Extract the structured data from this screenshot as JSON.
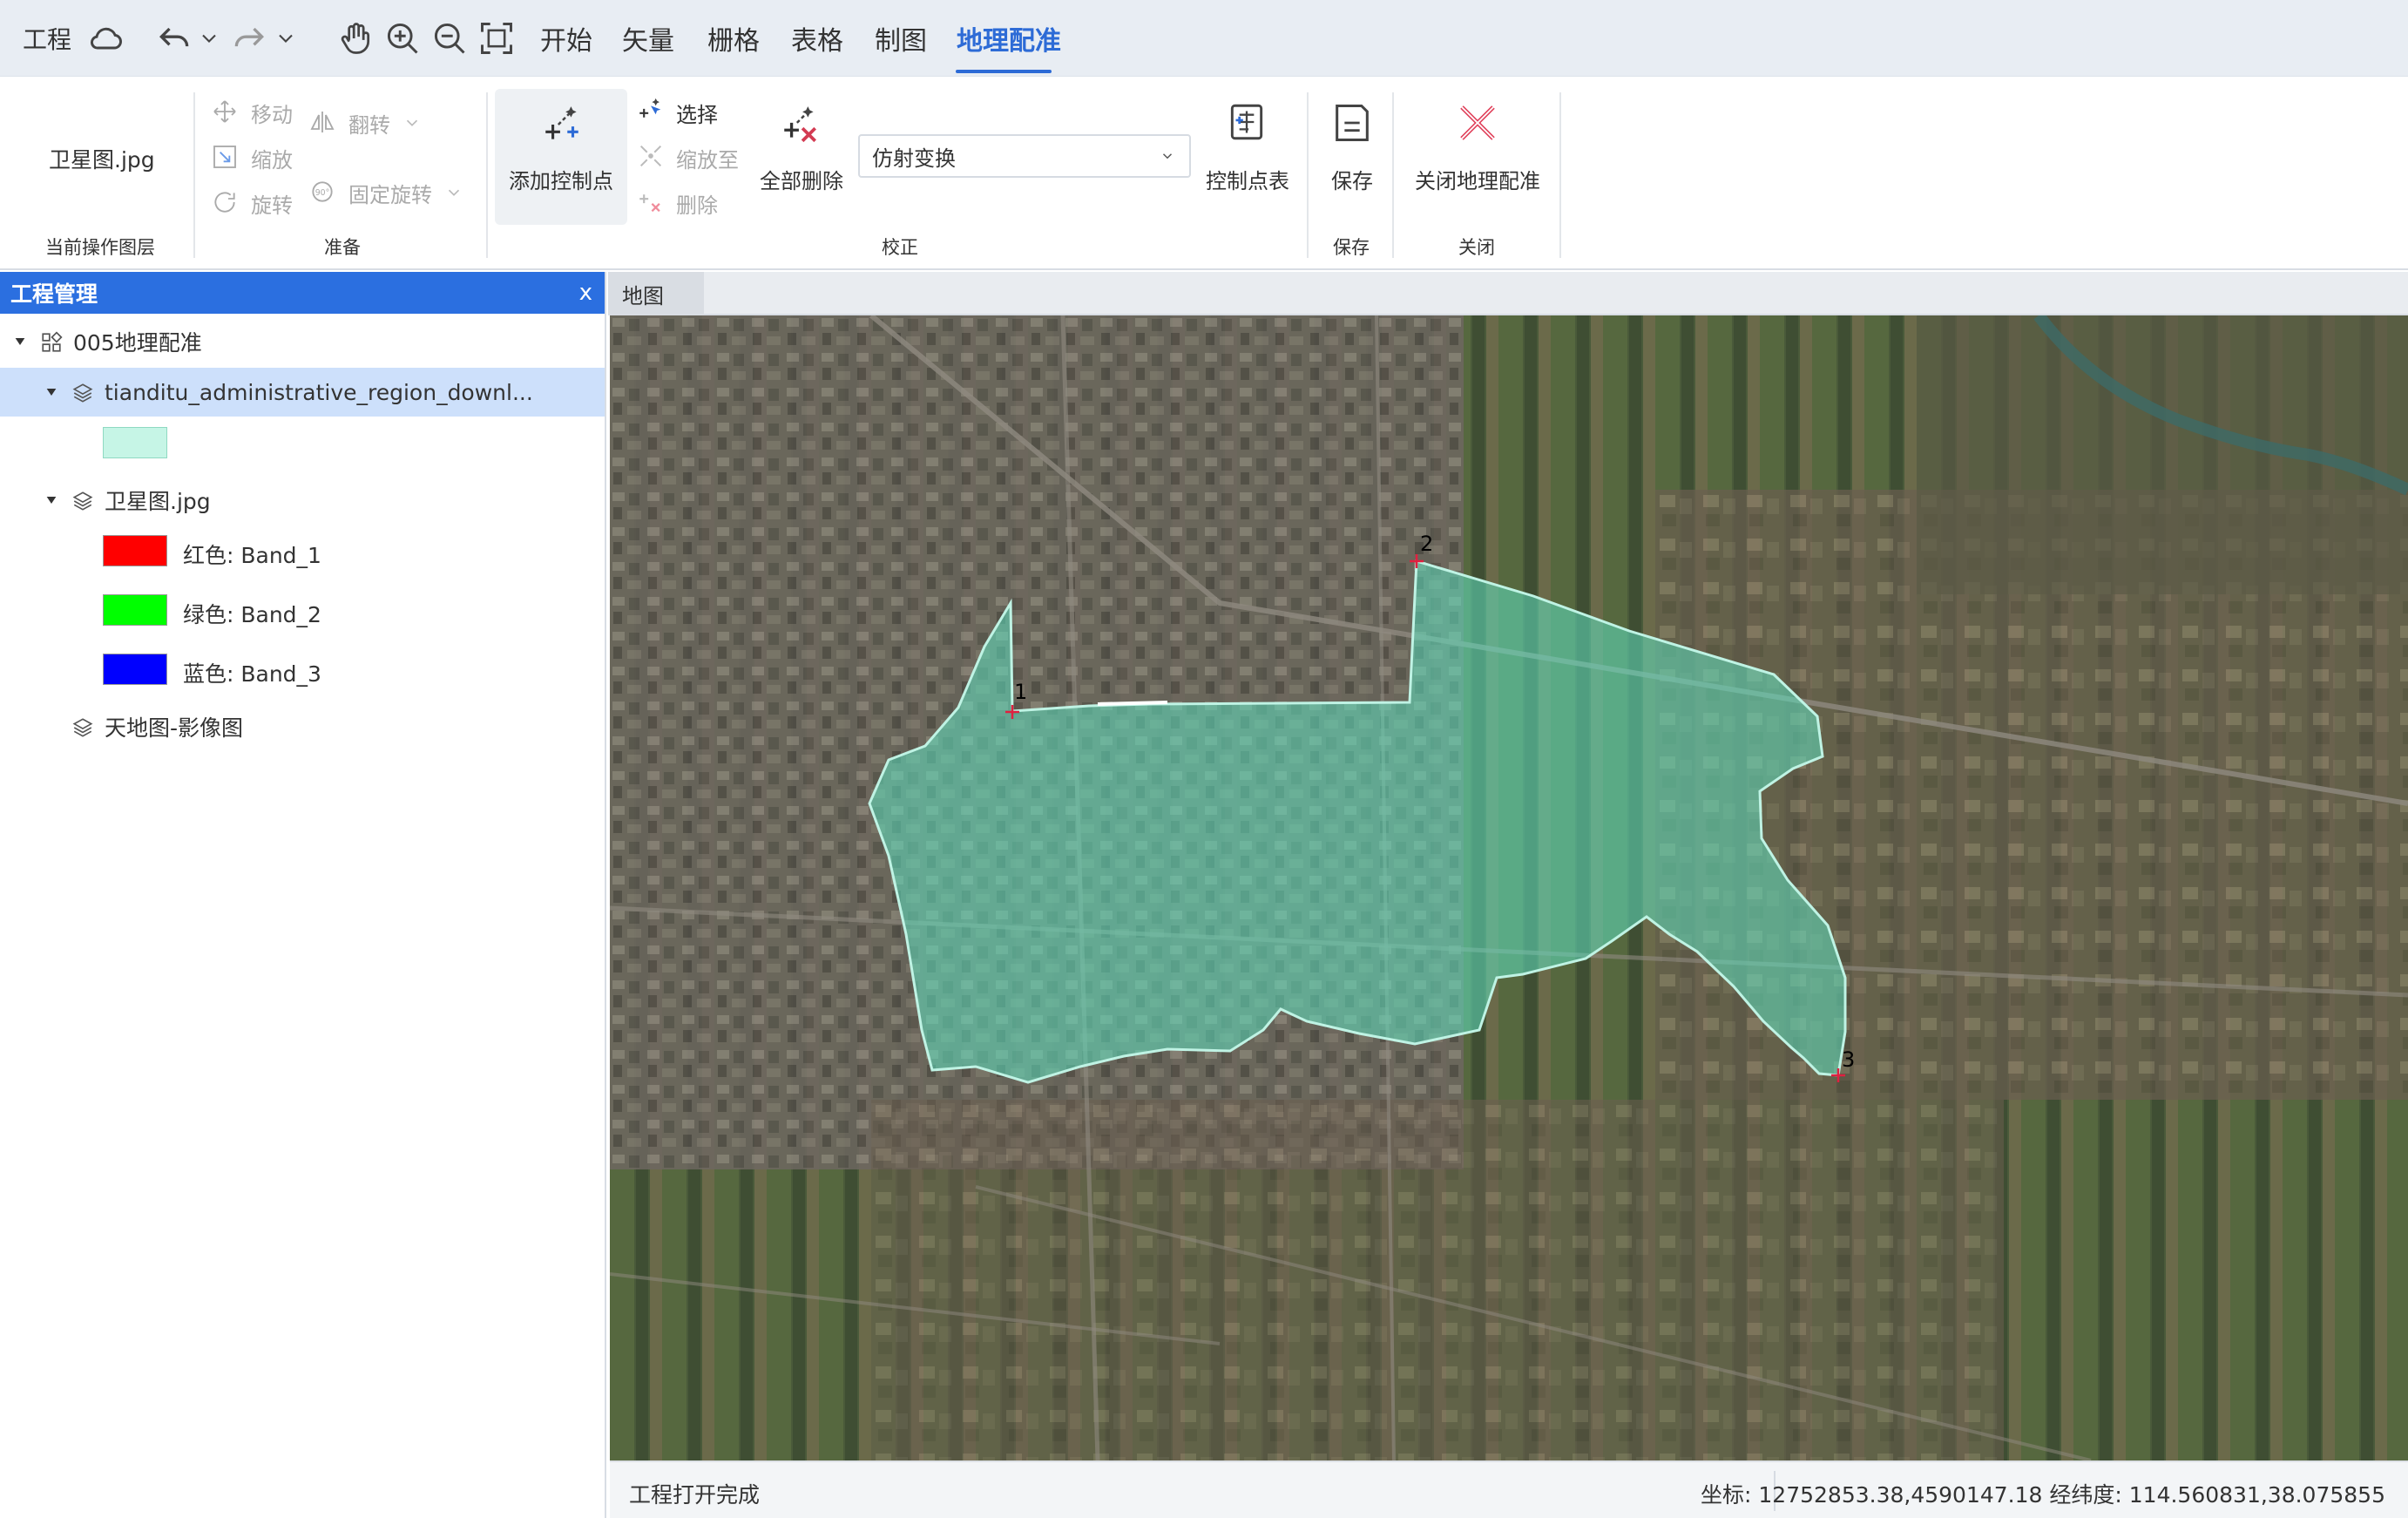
{
  "topbar": {
    "project_label": "工程",
    "menus": [
      "开始",
      "矢量",
      "栅格",
      "表格",
      "制图",
      "地理配准"
    ],
    "active_menu": "地理配准",
    "accent": "#2d6bd6"
  },
  "ribbon": {
    "current_layer": {
      "value": "卫星图.jpg",
      "group_label": "当前操作图层"
    },
    "prepare": {
      "move": "移动",
      "flip": "翻转",
      "scale": "缩放",
      "rotate": "旋转",
      "fixed_rotate": "固定旋转",
      "group_label": "准备"
    },
    "correct": {
      "add_control_point": "添加控制点",
      "select": "选择",
      "zoom_to": "缩放至",
      "delete": "删除",
      "delete_all": "全部删除",
      "transform": "仿射变换",
      "control_table": "控制点表",
      "group_label": "校正"
    },
    "save": {
      "label": "保存",
      "group_label": "保存"
    },
    "close": {
      "label": "关闭地理配准",
      "group_label": "关闭"
    }
  },
  "panel": {
    "title": "工程管理",
    "close": "x",
    "tree": {
      "root": "005地理配准",
      "layer1": "tianditu_administrative_region_downl...",
      "layer2": "卫星图.jpg",
      "bands": [
        {
          "label": "红色: Band_1",
          "color": "#ff0000"
        },
        {
          "label": "绿色: Band_2",
          "color": "#00ff00"
        },
        {
          "label": "蓝色: Band_3",
          "color": "#0000ff"
        }
      ],
      "layer3": "天地图-影像图",
      "layer1_swatch": "#c6f5e6"
    }
  },
  "map": {
    "tab": "地图",
    "control_points": [
      "1",
      "2",
      "3"
    ],
    "polygon_color": "#5fe0c0"
  },
  "status": {
    "left": "工程打开完成",
    "right": "坐标: 12752853.38,4590147.18 经纬度: 114.560831,38.075855"
  }
}
